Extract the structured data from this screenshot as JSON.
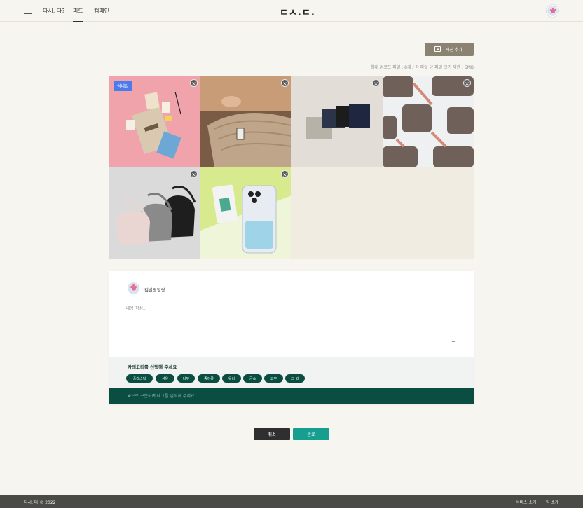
{
  "header": {
    "nav": [
      "다시, 다?",
      "피드",
      "캠페인"
    ],
    "active_nav": "피드",
    "logo": "ㄷㅅ.ㄷ."
  },
  "upload": {
    "add_photo_label": "사진 추가",
    "limit_text": "최대 업로드 파일 : 8개 / 각 파일 당 파일 크기 제한 : 5MB"
  },
  "thumbnail_badge": "썸네일",
  "photos_count": 6,
  "post": {
    "username": "김발랑발랑",
    "content_placeholder": "내용 작성...",
    "category_title": "카테고리를 선택해 주세요",
    "categories": [
      "플라스틱",
      "섬유",
      "나무",
      "종이류",
      "유리",
      "금속",
      "고무",
      "그 외"
    ],
    "tag_placeholder": "#으로 구분하여 태그를 입력해 주세요..."
  },
  "actions": {
    "cancel": "취소",
    "done": "완료"
  },
  "footer": {
    "copyright": "다시, 다 © 2022",
    "links": [
      "서비스 소개",
      "팀 소개"
    ]
  },
  "colors": {
    "background": "#f7f5f0",
    "primary_green": "#0a4d41",
    "teal": "#169e8f",
    "add_photo_button": "#8b8272",
    "badge_blue": "#4b7bec"
  }
}
